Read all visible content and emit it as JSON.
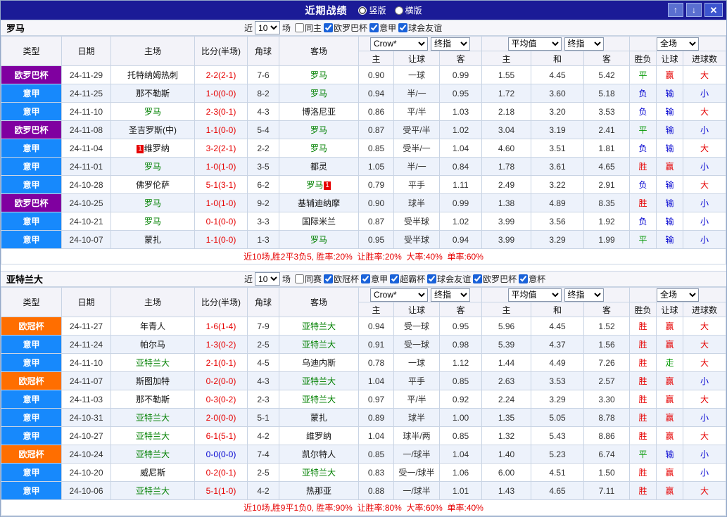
{
  "titlebar": {
    "title": "近期战绩",
    "radios": [
      {
        "label": "竖版",
        "checked": true
      },
      {
        "label": "横版",
        "checked": false
      }
    ],
    "up_icon": "↑",
    "down_icon": "↓",
    "close_icon": "✕"
  },
  "table_head": {
    "type": "类型",
    "date": "日期",
    "home": "主场",
    "score": "比分(半场)",
    "corner": "角球",
    "away": "客场",
    "h_home": "主",
    "h_let": "让球",
    "h_away": "客",
    "o_home": "主",
    "o_draw": "和",
    "o_away": "客",
    "result": "胜负",
    "let2": "让球",
    "goals": "进球数"
  },
  "colors": {
    "titlebar_bg": "#1b1b97",
    "europa_league": "#8000a0",
    "serie_a": "#1789fc",
    "champions_league": "#ff6e00",
    "focus_team": "#008000",
    "win_red": "#e60000",
    "draw_green": "#009700",
    "lose_blue": "#0000d0"
  },
  "sections": [
    {
      "team": "罗马",
      "filter": {
        "near": "近",
        "games": "10",
        "unit": "场",
        "checkboxes": [
          {
            "label": "同主",
            "checked": false
          },
          {
            "label": "欧罗巴杯",
            "checked": true
          },
          {
            "label": "意甲",
            "checked": true
          },
          {
            "label": "球会友谊",
            "checked": true
          }
        ]
      },
      "selects": {
        "company": "Crow*",
        "final_a": "终指",
        "avg": "平均值",
        "final_b": "终指",
        "scope": "全场"
      },
      "rows": [
        {
          "type": "欧罗巴杯",
          "type_class": "europa",
          "date": "24-11-29",
          "home": "托特纳姆热刺",
          "home_focus": false,
          "home_mark": "",
          "score": "2-2(2-1)",
          "score_class": "red",
          "corner": "7-6",
          "away": "罗马",
          "away_focus": true,
          "away_mark": "",
          "h1": "0.90",
          "let": "一球",
          "h2": "0.99",
          "o1": "1.55",
          "o2": "4.45",
          "o3": "5.42",
          "res": "平",
          "res_class": "green",
          "lb": "赢",
          "lb_class": "red",
          "goals": "大",
          "goals_class": "red"
        },
        {
          "type": "意甲",
          "type_class": "seriea",
          "date": "24-11-25",
          "home": "那不勒斯",
          "home_focus": false,
          "home_mark": "",
          "score": "1-0(0-0)",
          "score_class": "red",
          "corner": "8-2",
          "away": "罗马",
          "away_focus": true,
          "away_mark": "",
          "h1": "0.94",
          "let": "半/一",
          "h2": "0.95",
          "o1": "1.72",
          "o2": "3.60",
          "o3": "5.18",
          "res": "负",
          "res_class": "blue",
          "lb": "输",
          "lb_class": "blue",
          "goals": "小",
          "goals_class": "blue"
        },
        {
          "type": "意甲",
          "type_class": "seriea",
          "date": "24-11-10",
          "home": "罗马",
          "home_focus": true,
          "home_mark": "",
          "score": "2-3(0-1)",
          "score_class": "red",
          "corner": "4-3",
          "away": "博洛尼亚",
          "away_focus": false,
          "away_mark": "",
          "h1": "0.86",
          "let": "平/半",
          "h2": "1.03",
          "o1": "2.18",
          "o2": "3.20",
          "o3": "3.53",
          "res": "负",
          "res_class": "blue",
          "lb": "输",
          "lb_class": "blue",
          "goals": "大",
          "goals_class": "red"
        },
        {
          "type": "欧罗巴杯",
          "type_class": "europa",
          "date": "24-11-08",
          "home": "圣吉罗斯(中)",
          "home_focus": false,
          "home_mark": "",
          "score": "1-1(0-0)",
          "score_class": "red",
          "corner": "5-4",
          "away": "罗马",
          "away_focus": true,
          "away_mark": "",
          "h1": "0.87",
          "let": "受平/半",
          "h2": "1.02",
          "o1": "3.04",
          "o2": "3.19",
          "o3": "2.41",
          "res": "平",
          "res_class": "green",
          "lb": "输",
          "lb_class": "blue",
          "goals": "小",
          "goals_class": "blue"
        },
        {
          "type": "意甲",
          "type_class": "seriea",
          "date": "24-11-04",
          "home": "维罗纳",
          "home_focus": false,
          "home_mark": "1",
          "score": "3-2(2-1)",
          "score_class": "red",
          "corner": "2-2",
          "away": "罗马",
          "away_focus": true,
          "away_mark": "",
          "h1": "0.85",
          "let": "受半/一",
          "h2": "1.04",
          "o1": "4.60",
          "o2": "3.51",
          "o3": "1.81",
          "res": "负",
          "res_class": "blue",
          "lb": "输",
          "lb_class": "blue",
          "goals": "大",
          "goals_class": "red"
        },
        {
          "type": "意甲",
          "type_class": "seriea",
          "date": "24-11-01",
          "home": "罗马",
          "home_focus": true,
          "home_mark": "",
          "score": "1-0(1-0)",
          "score_class": "red",
          "corner": "3-5",
          "away": "都灵",
          "away_focus": false,
          "away_mark": "",
          "h1": "1.05",
          "let": "半/一",
          "h2": "0.84",
          "o1": "1.78",
          "o2": "3.61",
          "o3": "4.65",
          "res": "胜",
          "res_class": "red",
          "lb": "赢",
          "lb_class": "red",
          "goals": "小",
          "goals_class": "blue"
        },
        {
          "type": "意甲",
          "type_class": "seriea",
          "date": "24-10-28",
          "home": "佛罗伦萨",
          "home_focus": false,
          "home_mark": "",
          "score": "5-1(3-1)",
          "score_class": "red",
          "corner": "6-2",
          "away": "罗马",
          "away_focus": true,
          "away_mark": "1",
          "h1": "0.79",
          "let": "平手",
          "h2": "1.11",
          "o1": "2.49",
          "o2": "3.22",
          "o3": "2.91",
          "res": "负",
          "res_class": "blue",
          "lb": "输",
          "lb_class": "blue",
          "goals": "大",
          "goals_class": "red"
        },
        {
          "type": "欧罗巴杯",
          "type_class": "europa",
          "date": "24-10-25",
          "home": "罗马",
          "home_focus": true,
          "home_mark": "",
          "score": "1-0(1-0)",
          "score_class": "red",
          "corner": "9-2",
          "away": "基辅迪纳摩",
          "away_focus": false,
          "away_mark": "",
          "h1": "0.90",
          "let": "球半",
          "h2": "0.99",
          "o1": "1.38",
          "o2": "4.89",
          "o3": "8.35",
          "res": "胜",
          "res_class": "red",
          "lb": "输",
          "lb_class": "blue",
          "goals": "小",
          "goals_class": "blue"
        },
        {
          "type": "意甲",
          "type_class": "seriea",
          "date": "24-10-21",
          "home": "罗马",
          "home_focus": true,
          "home_mark": "",
          "score": "0-1(0-0)",
          "score_class": "red",
          "corner": "3-3",
          "away": "国际米兰",
          "away_focus": false,
          "away_mark": "",
          "h1": "0.87",
          "let": "受半球",
          "h2": "1.02",
          "o1": "3.99",
          "o2": "3.56",
          "o3": "1.92",
          "res": "负",
          "res_class": "blue",
          "lb": "输",
          "lb_class": "blue",
          "goals": "小",
          "goals_class": "blue"
        },
        {
          "type": "意甲",
          "type_class": "seriea",
          "date": "24-10-07",
          "home": "蒙扎",
          "home_focus": false,
          "home_mark": "",
          "score": "1-1(0-0)",
          "score_class": "red",
          "corner": "1-3",
          "away": "罗马",
          "away_focus": true,
          "away_mark": "",
          "h1": "0.95",
          "let": "受半球",
          "h2": "0.94",
          "o1": "3.99",
          "o2": "3.29",
          "o3": "1.99",
          "res": "平",
          "res_class": "green",
          "lb": "输",
          "lb_class": "blue",
          "goals": "小",
          "goals_class": "blue"
        }
      ],
      "footer": "近10场,胜2平3负5, 胜率:20%  让胜率:20%  大率:40%  单率:60%"
    },
    {
      "team": "亚特兰大",
      "filter": {
        "near": "近",
        "games": "10",
        "unit": "场",
        "checkboxes": [
          {
            "label": "同赛",
            "checked": false
          },
          {
            "label": "欧冠杯",
            "checked": true
          },
          {
            "label": "意甲",
            "checked": true
          },
          {
            "label": "超霸杯",
            "checked": true
          },
          {
            "label": "球会友谊",
            "checked": true
          },
          {
            "label": "欧罗巴杯",
            "checked": true
          },
          {
            "label": "意杯",
            "checked": true
          }
        ]
      },
      "selects": {
        "company": "Crow*",
        "final_a": "终指",
        "avg": "平均值",
        "final_b": "终指",
        "scope": "全场"
      },
      "rows": [
        {
          "type": "欧冠杯",
          "type_class": "ucl",
          "date": "24-11-27",
          "home": "年青人",
          "home_focus": false,
          "home_mark": "",
          "score": "1-6(1-4)",
          "score_class": "red",
          "corner": "7-9",
          "away": "亚特兰大",
          "away_focus": true,
          "away_mark": "",
          "h1": "0.94",
          "let": "受一球",
          "h2": "0.95",
          "o1": "5.96",
          "o2": "4.45",
          "o3": "1.52",
          "res": "胜",
          "res_class": "red",
          "lb": "赢",
          "lb_class": "red",
          "goals": "大",
          "goals_class": "red"
        },
        {
          "type": "意甲",
          "type_class": "seriea",
          "date": "24-11-24",
          "home": "帕尔马",
          "home_focus": false,
          "home_mark": "",
          "score": "1-3(0-2)",
          "score_class": "red",
          "corner": "2-5",
          "away": "亚特兰大",
          "away_focus": true,
          "away_mark": "",
          "h1": "0.91",
          "let": "受一球",
          "h2": "0.98",
          "o1": "5.39",
          "o2": "4.37",
          "o3": "1.56",
          "res": "胜",
          "res_class": "red",
          "lb": "赢",
          "lb_class": "red",
          "goals": "大",
          "goals_class": "red"
        },
        {
          "type": "意甲",
          "type_class": "seriea",
          "date": "24-11-10",
          "home": "亚特兰大",
          "home_focus": true,
          "home_mark": "",
          "score": "2-1(0-1)",
          "score_class": "red",
          "corner": "4-5",
          "away": "乌迪内斯",
          "away_focus": false,
          "away_mark": "",
          "h1": "0.78",
          "let": "一球",
          "h2": "1.12",
          "o1": "1.44",
          "o2": "4.49",
          "o3": "7.26",
          "res": "胜",
          "res_class": "red",
          "lb": "走",
          "lb_class": "green",
          "goals": "大",
          "goals_class": "red"
        },
        {
          "type": "欧冠杯",
          "type_class": "ucl",
          "date": "24-11-07",
          "home": "斯图加特",
          "home_focus": false,
          "home_mark": "",
          "score": "0-2(0-0)",
          "score_class": "red",
          "corner": "4-3",
          "away": "亚特兰大",
          "away_focus": true,
          "away_mark": "",
          "h1": "1.04",
          "let": "平手",
          "h2": "0.85",
          "o1": "2.63",
          "o2": "3.53",
          "o3": "2.57",
          "res": "胜",
          "res_class": "red",
          "lb": "赢",
          "lb_class": "red",
          "goals": "小",
          "goals_class": "blue"
        },
        {
          "type": "意甲",
          "type_class": "seriea",
          "date": "24-11-03",
          "home": "那不勒斯",
          "home_focus": false,
          "home_mark": "",
          "score": "0-3(0-2)",
          "score_class": "red",
          "corner": "2-3",
          "away": "亚特兰大",
          "away_focus": true,
          "away_mark": "",
          "h1": "0.97",
          "let": "平/半",
          "h2": "0.92",
          "o1": "2.24",
          "o2": "3.29",
          "o3": "3.30",
          "res": "胜",
          "res_class": "red",
          "lb": "赢",
          "lb_class": "red",
          "goals": "大",
          "goals_class": "red"
        },
        {
          "type": "意甲",
          "type_class": "seriea",
          "date": "24-10-31",
          "home": "亚特兰大",
          "home_focus": true,
          "home_mark": "",
          "score": "2-0(0-0)",
          "score_class": "red",
          "corner": "5-1",
          "away": "蒙扎",
          "away_focus": false,
          "away_mark": "",
          "h1": "0.89",
          "let": "球半",
          "h2": "1.00",
          "o1": "1.35",
          "o2": "5.05",
          "o3": "8.78",
          "res": "胜",
          "res_class": "red",
          "lb": "赢",
          "lb_class": "red",
          "goals": "小",
          "goals_class": "blue"
        },
        {
          "type": "意甲",
          "type_class": "seriea",
          "date": "24-10-27",
          "home": "亚特兰大",
          "home_focus": true,
          "home_mark": "",
          "score": "6-1(5-1)",
          "score_class": "red",
          "corner": "4-2",
          "away": "维罗纳",
          "away_focus": false,
          "away_mark": "",
          "h1": "1.04",
          "let": "球半/两",
          "h2": "0.85",
          "o1": "1.32",
          "o2": "5.43",
          "o3": "8.86",
          "res": "胜",
          "res_class": "red",
          "lb": "赢",
          "lb_class": "red",
          "goals": "大",
          "goals_class": "red"
        },
        {
          "type": "欧冠杯",
          "type_class": "ucl",
          "date": "24-10-24",
          "home": "亚特兰大",
          "home_focus": true,
          "home_mark": "",
          "score": "0-0(0-0)",
          "score_class": "blue",
          "corner": "7-4",
          "away": "凯尔特人",
          "away_focus": false,
          "away_mark": "",
          "h1": "0.85",
          "let": "一/球半",
          "h2": "1.04",
          "o1": "1.40",
          "o2": "5.23",
          "o3": "6.74",
          "res": "平",
          "res_class": "green",
          "lb": "输",
          "lb_class": "blue",
          "goals": "小",
          "goals_class": "blue"
        },
        {
          "type": "意甲",
          "type_class": "seriea",
          "date": "24-10-20",
          "home": "威尼斯",
          "home_focus": false,
          "home_mark": "",
          "score": "0-2(0-1)",
          "score_class": "red",
          "corner": "2-5",
          "away": "亚特兰大",
          "away_focus": true,
          "away_mark": "",
          "h1": "0.83",
          "let": "受一/球半",
          "h2": "1.06",
          "o1": "6.00",
          "o2": "4.51",
          "o3": "1.50",
          "res": "胜",
          "res_class": "red",
          "lb": "赢",
          "lb_class": "red",
          "goals": "小",
          "goals_class": "blue"
        },
        {
          "type": "意甲",
          "type_class": "seriea",
          "date": "24-10-06",
          "home": "亚特兰大",
          "home_focus": true,
          "home_mark": "",
          "score": "5-1(1-0)",
          "score_class": "red",
          "corner": "4-2",
          "away": "热那亚",
          "away_focus": false,
          "away_mark": "",
          "h1": "0.88",
          "let": "一/球半",
          "h2": "1.01",
          "o1": "1.43",
          "o2": "4.65",
          "o3": "7.11",
          "res": "胜",
          "res_class": "red",
          "lb": "赢",
          "lb_class": "red",
          "goals": "大",
          "goals_class": "red"
        }
      ],
      "footer": "近10场,胜9平1负0, 胜率:90%  让胜率:80%  大率:60%  单率:40%"
    }
  ]
}
